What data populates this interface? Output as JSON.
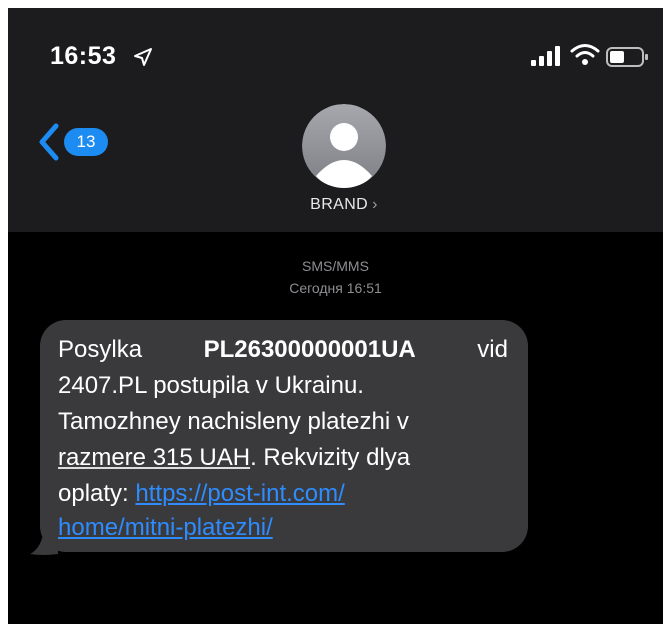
{
  "status_bar": {
    "time": "16:53"
  },
  "nav": {
    "back_count": "13",
    "contact_name": "BRAND",
    "contact_chevron": "›"
  },
  "thread": {
    "service": "SMS/MMS",
    "timestamp": "Сегодня 16:51"
  },
  "message": {
    "w_posylka": "Posylka",
    "tracking_number": "PL26300000001UA",
    "w_vid": "vid",
    "line2": "2407.PL postupila v Ukrainu.",
    "line3": "Tamozhney nachisleny platezhi v",
    "line4_underlined": "razmere 315 UAH",
    "line4_rest": ". Rekvizity dlya",
    "line5_text": "oplaty: ",
    "link_part1": "https://post-int.com/",
    "link_part2": "home/mitni-platezhi/"
  },
  "colors": {
    "header_bg": "#1c1c1e",
    "screen_bg": "#000000",
    "bubble_bg": "#3a3a3c",
    "accent_blue": "#1c8bf2",
    "link_blue": "#2e8cff",
    "meta_gray": "#8e8e93"
  },
  "icons": {
    "location": "location-arrow-icon",
    "signal": "cellular-signal-icon",
    "wifi": "wifi-icon",
    "battery": "battery-icon",
    "back": "chevron-left-icon",
    "avatar": "person-avatar-icon"
  }
}
